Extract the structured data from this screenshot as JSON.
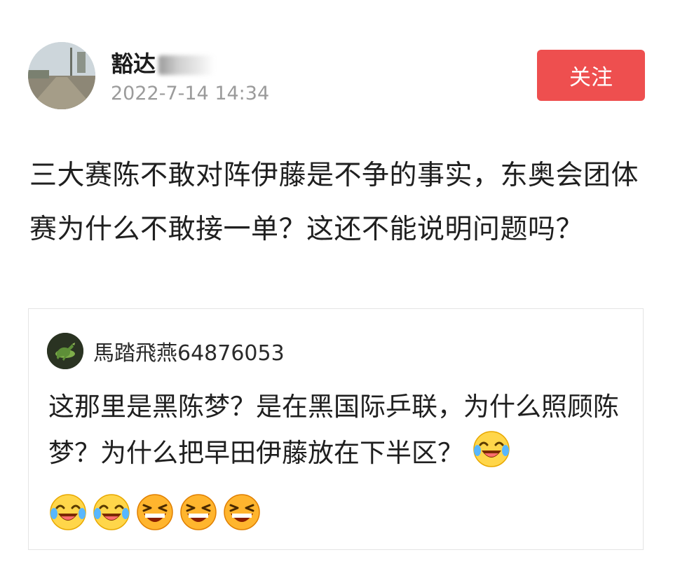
{
  "author": {
    "name": "豁达",
    "avatar_icon": "road-scene-avatar",
    "timestamp": "2022-7-14 14:34"
  },
  "follow_button": {
    "label": "关注",
    "color": "#ee4f4f"
  },
  "post": {
    "text": "三大赛陈不敢对阵伊藤是不争的事实，东奥会团体赛为什么不敢接一单？这还不能说明问题吗？"
  },
  "quoted_comment": {
    "author": "馬踏飛燕64876053",
    "avatar_icon": "galloping-horse-avatar",
    "text": "这那里是黑陈梦？是在黑国际乒联，为什么照顾陈梦？为什么把早田伊藤放在下半区？",
    "trailing_emoji": "laugh-cry-emoji",
    "emoji_row": [
      "laugh-cry-emoji",
      "laugh-cry-emoji",
      "big-grin-emoji",
      "big-grin-emoji",
      "big-grin-emoji"
    ]
  }
}
